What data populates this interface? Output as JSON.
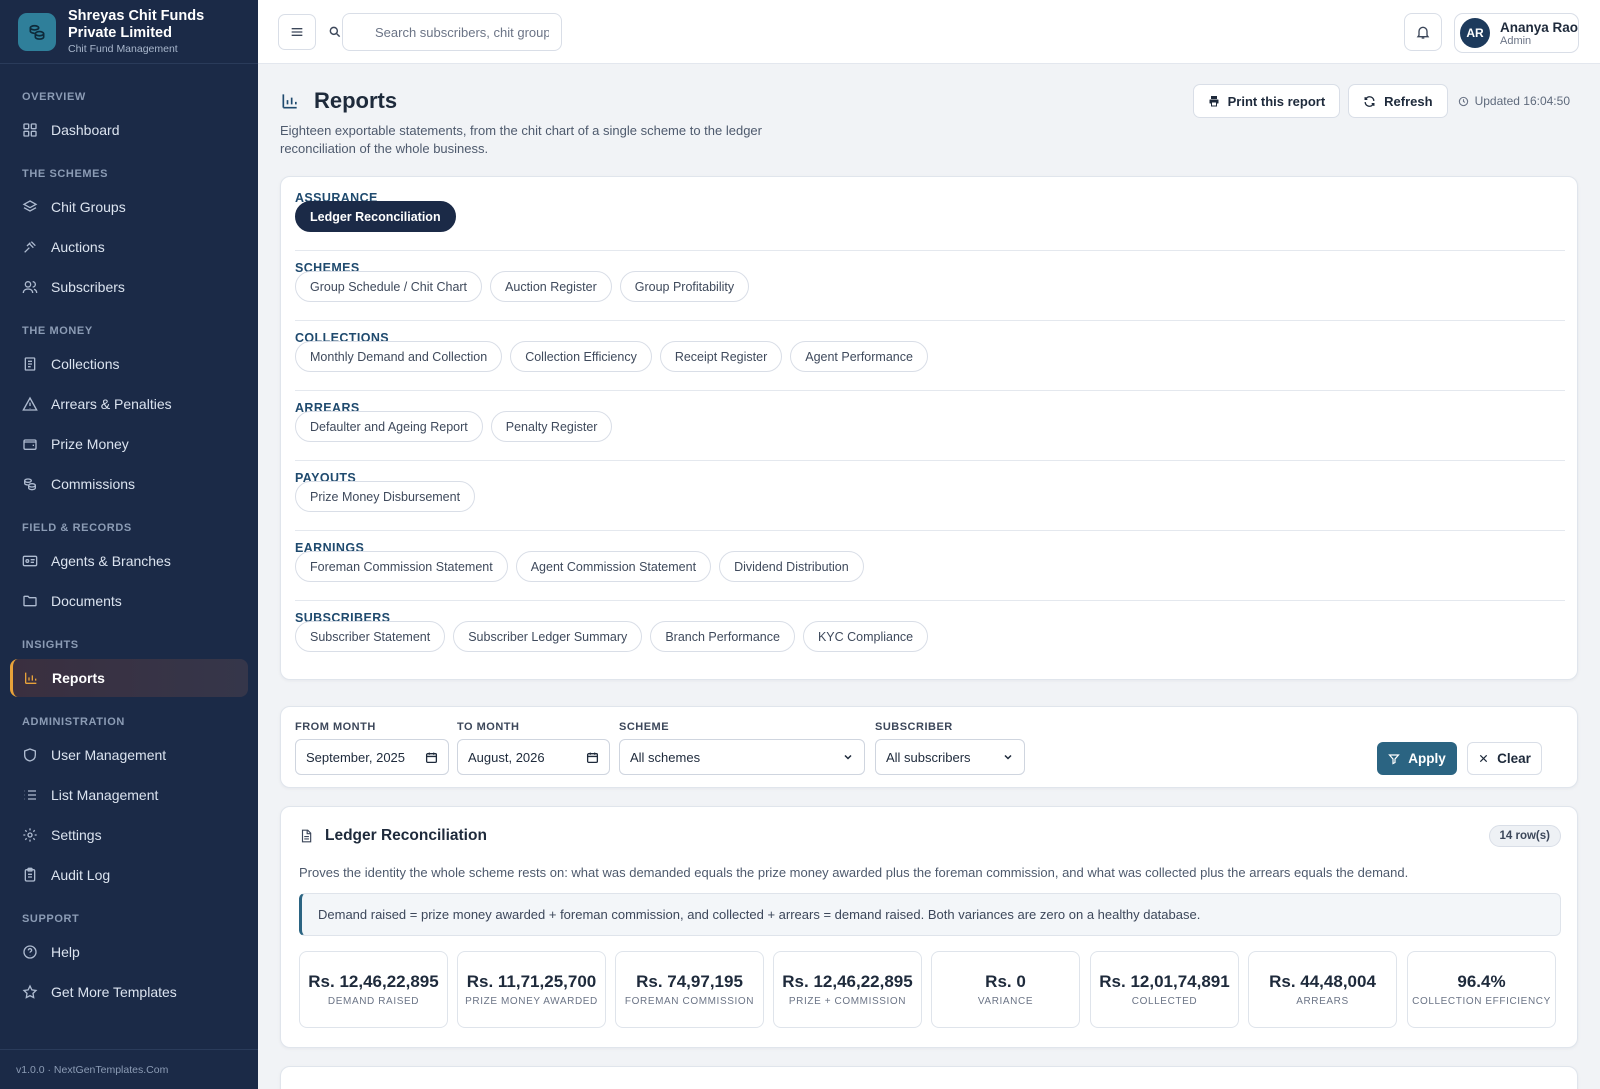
{
  "brand": {
    "name": "Shreyas Chit Funds Private Limited",
    "subtitle": "Chit Fund Management"
  },
  "sidebar": {
    "sections": [
      {
        "title": "Overview",
        "items": [
          {
            "label": "Dashboard",
            "icon": "dashboard-icon"
          }
        ]
      },
      {
        "title": "The Schemes",
        "items": [
          {
            "label": "Chit Groups",
            "icon": "layers-icon"
          },
          {
            "label": "Auctions",
            "icon": "gavel-icon"
          },
          {
            "label": "Subscribers",
            "icon": "users-icon"
          }
        ]
      },
      {
        "title": "The Money",
        "items": [
          {
            "label": "Collections",
            "icon": "receipt-icon"
          },
          {
            "label": "Arrears & Penalties",
            "icon": "warning-icon"
          },
          {
            "label": "Prize Money",
            "icon": "wallet-icon"
          },
          {
            "label": "Commissions",
            "icon": "coins-icon"
          }
        ]
      },
      {
        "title": "Field & Records",
        "items": [
          {
            "label": "Agents & Branches",
            "icon": "id-card-icon"
          },
          {
            "label": "Documents",
            "icon": "folder-icon"
          }
        ]
      },
      {
        "title": "Insights",
        "items": [
          {
            "label": "Reports",
            "icon": "bar-chart-icon",
            "active": true
          }
        ]
      },
      {
        "title": "Administration",
        "items": [
          {
            "label": "User Management",
            "icon": "shield-icon"
          },
          {
            "label": "List Management",
            "icon": "list-icon"
          },
          {
            "label": "Settings",
            "icon": "gear-icon"
          },
          {
            "label": "Audit Log",
            "icon": "clipboard-icon"
          }
        ]
      },
      {
        "title": "Support",
        "items": [
          {
            "label": "Help",
            "icon": "help-icon"
          },
          {
            "label": "Get More Templates",
            "icon": "star-icon"
          }
        ]
      }
    ],
    "footer": "v1.0.0 · NextGenTemplates.Com"
  },
  "topbar": {
    "search_placeholder": "Search subscribers, chit groups",
    "user": {
      "initials": "AR",
      "name": "Ananya Rao",
      "role": "Admin"
    }
  },
  "page": {
    "title": "Reports",
    "description": "Eighteen exportable statements, from the chit chart of a single scheme to the ledger reconciliation of the whole business.",
    "print_label": "Print this report",
    "refresh_label": "Refresh",
    "updated_text": "Updated 16:04:50"
  },
  "catalog": [
    {
      "title": "Assurance",
      "reports": [
        {
          "label": "Ledger Reconciliation",
          "active": true
        }
      ]
    },
    {
      "title": "Schemes",
      "reports": [
        {
          "label": "Group Schedule / Chit Chart"
        },
        {
          "label": "Auction Register"
        },
        {
          "label": "Group Profitability"
        }
      ]
    },
    {
      "title": "Collections",
      "reports": [
        {
          "label": "Monthly Demand and Collection"
        },
        {
          "label": "Collection Efficiency"
        },
        {
          "label": "Receipt Register"
        },
        {
          "label": "Agent Performance"
        }
      ]
    },
    {
      "title": "Arrears",
      "reports": [
        {
          "label": "Defaulter and Ageing Report"
        },
        {
          "label": "Penalty Register"
        }
      ]
    },
    {
      "title": "Payouts",
      "reports": [
        {
          "label": "Prize Money Disbursement"
        }
      ]
    },
    {
      "title": "Earnings",
      "reports": [
        {
          "label": "Foreman Commission Statement"
        },
        {
          "label": "Agent Commission Statement"
        },
        {
          "label": "Dividend Distribution"
        }
      ]
    },
    {
      "title": "Subscribers",
      "reports": [
        {
          "label": "Subscriber Statement"
        },
        {
          "label": "Subscriber Ledger Summary"
        },
        {
          "label": "Branch Performance"
        },
        {
          "label": "KYC Compliance"
        }
      ]
    }
  ],
  "filters": {
    "from_month": {
      "label": "From Month",
      "value": "September, 2025"
    },
    "to_month": {
      "label": "To Month",
      "value": "August, 2026"
    },
    "scheme": {
      "label": "Scheme",
      "value": "All schemes"
    },
    "subscriber": {
      "label": "Subscriber",
      "value": "All subscribers"
    },
    "apply_label": "Apply",
    "clear_label": "Clear"
  },
  "report": {
    "title": "Ledger Reconciliation",
    "row_count": "14 row(s)",
    "description": "Proves the identity the whole scheme rests on: what was demanded equals the prize money awarded plus the foreman commission, and what was collected plus the arrears equals the demand.",
    "note": "Demand raised = prize money awarded + foreman commission, and collected + arrears = demand raised. Both variances are zero on a healthy database.",
    "stats": [
      {
        "value": "Rs. 12,46,22,895",
        "label": "Demand Raised"
      },
      {
        "value": "Rs. 11,71,25,700",
        "label": "Prize Money Awarded"
      },
      {
        "value": "Rs. 74,97,195",
        "label": "Foreman Commission"
      },
      {
        "value": "Rs. 12,46,22,895",
        "label": "Prize + Commission"
      },
      {
        "value": "Rs. 0",
        "label": "Variance"
      },
      {
        "value": "Rs. 12,01,74,891",
        "label": "Collected"
      },
      {
        "value": "Rs. 44,48,004",
        "label": "Arrears"
      },
      {
        "value": "96.4%",
        "label": "Collection Efficiency"
      }
    ]
  },
  "colors": {
    "sidebar_bg": "#1b2a47",
    "accent": "#2b6482",
    "active_marker": "#e8a23a"
  }
}
